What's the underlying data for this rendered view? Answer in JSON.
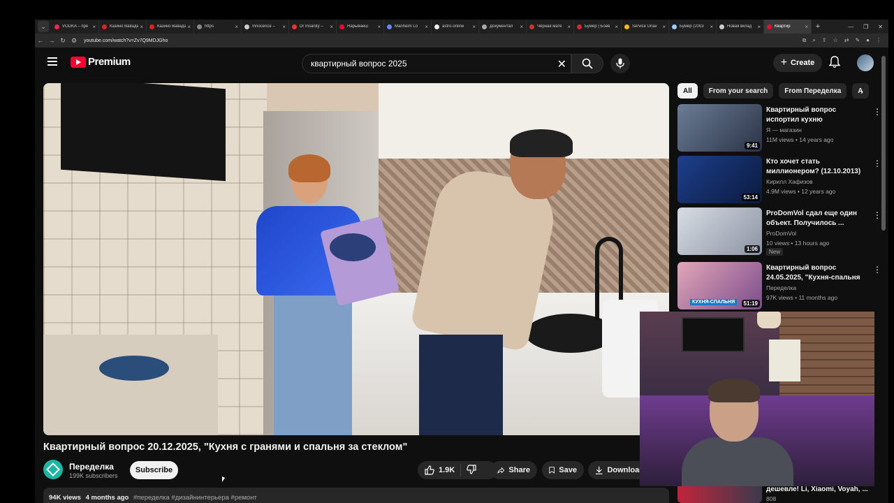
{
  "browser": {
    "tabs": [
      {
        "label": "VODKA – пре",
        "color": "#f25"
      },
      {
        "label": "Казино Вавада",
        "color": "#d22"
      },
      {
        "label": "Казино Вавада",
        "color": "#d22"
      },
      {
        "label": "https",
        "color": "#888"
      },
      {
        "label": "Innocence –",
        "color": "#ccc"
      },
      {
        "label": "Dr Insanity –",
        "color": "#e33"
      },
      {
        "label": "Нарываеш",
        "color": "#f03"
      },
      {
        "label": "Manheim Lo",
        "color": "#68f"
      },
      {
        "label": "astro-online",
        "color": "#eee"
      },
      {
        "label": "Документал",
        "color": "#aaa"
      },
      {
        "label": "Чёрная мате",
        "color": "#c33"
      },
      {
        "label": "Бумер | Боев",
        "color": "#d23"
      },
      {
        "label": "Service Unav",
        "color": "#fb0"
      },
      {
        "label": "Бумер (2003",
        "color": "#9cf"
      },
      {
        "label": "Новая вклад",
        "color": "#ccc"
      },
      {
        "label": "Квартир",
        "color": "#f03"
      }
    ],
    "url": "youtube.com/watch?v=Zv7Q9MDJGho"
  },
  "masthead": {
    "logo_text": "Premium",
    "search_value": "квартирный вопрос 2025",
    "create_label": "Create"
  },
  "video": {
    "title": "Квартирный вопрос 20.12.2025, \"Кухня с гранями и спальня за стеклом\"",
    "channel_name": "Переделка",
    "channel_subs": "199K subscribers",
    "subscribe_label": "Subscribe",
    "like_count": "1.9K",
    "share_label": "Share",
    "save_label": "Save",
    "download_label": "Download",
    "views": "94K views",
    "age": "4 months ago",
    "tags": "#переделка #дизайнинтерьера #ремонт"
  },
  "chips": [
    "All",
    "From your search",
    "From Переделка",
    "A"
  ],
  "recommendations": [
    {
      "title": "Квартирный вопрос испортил кухню",
      "channel": "Я — магазин",
      "meta": "11M views • 14 years ago",
      "duration": "9:41",
      "thumb_a": "#6a7d96",
      "thumb_b": "#2b3346"
    },
    {
      "title": "Кто хочет стать миллионером? (12.10.2013)",
      "channel": "Кирилл Хафизов",
      "meta": "4.9M views • 12 years ago",
      "duration": "53:14",
      "thumb_a": "#1d3f8c",
      "thumb_b": "#0b1a3d"
    },
    {
      "title": "ProDomVol сдал еще один объект. Получилось ...",
      "channel": "ProDomVol",
      "meta": "10 views • 13 hours ago",
      "duration": "1:06",
      "badge": "New",
      "thumb_a": "#d8dde4",
      "thumb_b": "#8b93a3"
    },
    {
      "title": "Квартирный вопрос 24.05.2025, \"Кухня-спальня н...",
      "channel": "Переделка",
      "meta": "97K views • 11 months ago",
      "duration": "51:19",
      "overlay": "КУХНЯ-СПАЛЬНЯ",
      "thumb_a": "#e3a7b8",
      "thumb_b": "#7a4c8c"
    }
  ],
  "partial_rec": {
    "title": "дешевле! Li, Xiaomi, Voyah, ...",
    "meta": "808"
  }
}
